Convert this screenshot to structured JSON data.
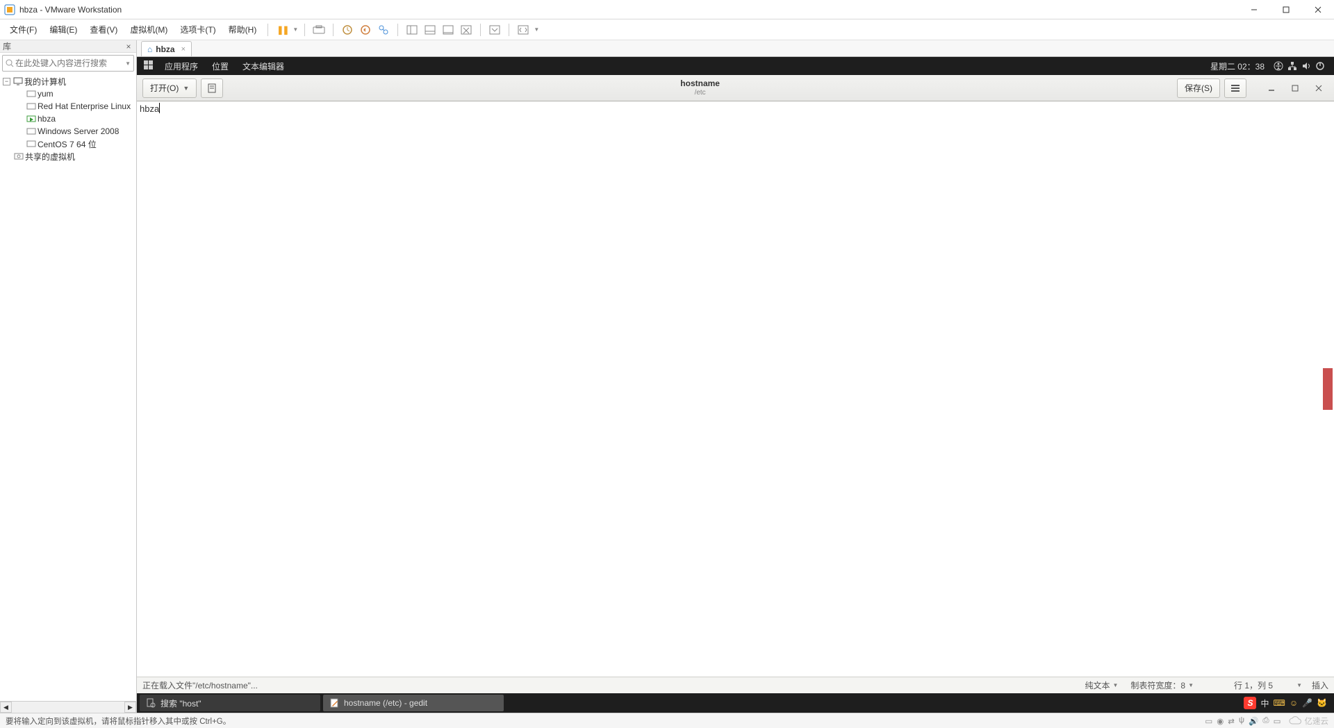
{
  "title": "hbza - VMware Workstation",
  "menubar": [
    "文件(F)",
    "编辑(E)",
    "查看(V)",
    "虚拟机(M)",
    "选项卡(T)",
    "帮助(H)"
  ],
  "library": {
    "header": "库",
    "search_placeholder": "在此处键入内容进行搜索",
    "tree": {
      "root": "我的计算机",
      "items": [
        "yum",
        "Red Hat Enterprise Linux",
        "hbza",
        "Windows Server 2008",
        "CentOS 7 64 位"
      ],
      "shared": "共享的虚拟机"
    }
  },
  "vm_tab": {
    "label": "hbza"
  },
  "gnome_top": {
    "applications": "应用程序",
    "places": "位置",
    "editor": "文本编辑器",
    "clock": "星期二 02：38"
  },
  "gedit": {
    "open_btn": "打开(O)",
    "save_btn": "保存(S)",
    "title_main": "hostname",
    "title_sub": "/etc",
    "editor_text": "hbza",
    "status_loading": "正在载入文件\"/etc/hostname\"...",
    "status_lang": "纯文本",
    "status_tab": "制表符宽度：8",
    "status_pos": "行 1，列 5",
    "status_ins": "插入"
  },
  "taskbar": {
    "item1": "搜索 \"host\"",
    "item2": "hostname (/etc) - gedit"
  },
  "tray_text": "中",
  "vm_status_text": "要将输入定向到该虚拟机，请将鼠标指针移入其中或按 Ctrl+G。",
  "cloud_brand": "亿速云"
}
